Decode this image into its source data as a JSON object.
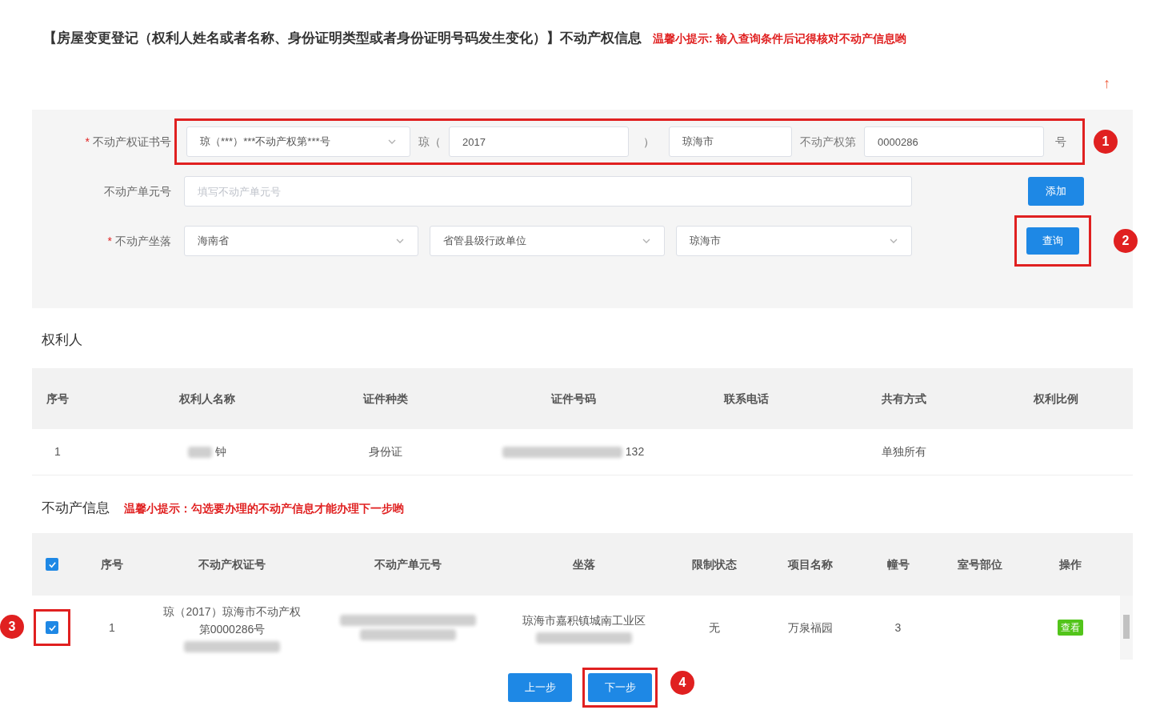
{
  "header": {
    "title": "【房屋变更登记（权利人姓名或者名称、身份证明类型或者身份证明号码发生变化）】不动产权信息",
    "tip": "温馨小提示: 输入查询条件后记得核对不动产信息哟",
    "collapse": "↑"
  },
  "query_form": {
    "certificate": {
      "required_mark": "*",
      "label": "不动产权证书号",
      "format_select": "琼（***）***不动产权第***号",
      "prefix": "琼（",
      "year": "2017",
      "close": "）",
      "city": "琼海市",
      "middle": "不动产权第",
      "number": "0000286",
      "suffix": "号",
      "highlighted": true,
      "marker": "1"
    },
    "unit": {
      "label": "不动产单元号",
      "placeholder": "填写不动产单元号",
      "button": "添加"
    },
    "location": {
      "required_mark": "*",
      "label": "不动产坐落",
      "selects": [
        "海南省",
        "省管县级行政单位",
        "琼海市"
      ],
      "button": "查询",
      "highlighted": true,
      "marker": "2"
    }
  },
  "owners": {
    "title": "权利人",
    "columns": [
      "序号",
      "权利人名称",
      "证件种类",
      "证件号码",
      "联系电话",
      "共有方式",
      "权利比例"
    ],
    "rows": [
      {
        "cells": [
          {
            "text": "1"
          },
          {
            "text": "钟",
            "redacted": true
          },
          {
            "text": "身份证"
          },
          {
            "text": "132",
            "redacted": true
          },
          null,
          {
            "text": "单独所有"
          },
          null
        ]
      }
    ]
  },
  "properties": {
    "title": "不动产信息",
    "tip": "温馨小提示：勾选要办理的不动产信息才能办理下一步哟",
    "select_all_checked": true,
    "columns": [
      "序号",
      "不动产权证号",
      "不动产单元号",
      "坐落",
      "限制状态",
      "项目名称",
      "幢号",
      "室号部位",
      "操作"
    ],
    "rows": [
      {
        "checked": true,
        "highlighted": true,
        "marker": "3",
        "cells": [
          {
            "kind": "text",
            "text": "1"
          },
          {
            "kind": "text",
            "text": "琼（2017）琼海市不动产权第0000286号",
            "redacted": true
          },
          {
            "kind": "blur"
          },
          {
            "kind": "text",
            "text": "琼海市嘉积镇城南工业区",
            "redacted": true
          },
          {
            "kind": "text",
            "text": "无"
          },
          {
            "kind": "text",
            "text": "万泉福园"
          },
          {
            "kind": "text",
            "text": "3"
          },
          null,
          {
            "kind": "tag",
            "text": "查看",
            "color": "#52c41a"
          }
        ]
      }
    ]
  },
  "footer_buttons": [
    {
      "label": "上一步",
      "highlighted": false
    },
    {
      "label": "下一步",
      "highlighted": true,
      "marker": "4"
    }
  ]
}
